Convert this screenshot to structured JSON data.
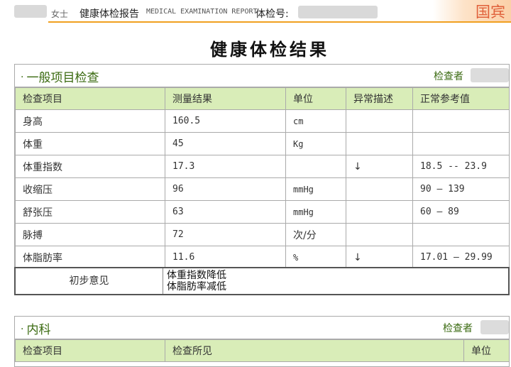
{
  "header": {
    "gender": "女士",
    "report_title": "健康体检报告",
    "report_title_en": "MEDICAL EXAMINATION REPORT",
    "exam_no_label": "体检号:",
    "logo_text": "国宾"
  },
  "page_title": "健康体检结果",
  "general_section": {
    "title": "一般项目检查",
    "examiner_label": "检查者",
    "columns": [
      "检查项目",
      "测量结果",
      "单位",
      "异常描述",
      "正常参考值"
    ],
    "rows": [
      {
        "item": "身高",
        "result": "160.5",
        "unit": "cm",
        "flag": "",
        "ref": ""
      },
      {
        "item": "体重",
        "result": "45",
        "unit": "Kg",
        "flag": "",
        "ref": ""
      },
      {
        "item": "体重指数",
        "result": "17.3",
        "unit": "",
        "flag": "↓",
        "ref": "18.5 -- 23.9"
      },
      {
        "item": "收缩压",
        "result": "96",
        "unit": "mmHg",
        "flag": "",
        "ref": "90 — 139"
      },
      {
        "item": "舒张压",
        "result": "63",
        "unit": "mmHg",
        "flag": "",
        "ref": "60 — 89"
      },
      {
        "item": "脉搏",
        "result": "72",
        "unit": "次/分",
        "flag": "",
        "ref": ""
      },
      {
        "item": "体脂肪率",
        "result": "11.6",
        "unit": "%",
        "flag": "↓",
        "ref": "17.01 — 29.99"
      }
    ],
    "opinion_label": "初步意见",
    "opinion_lines": [
      "体重指数降低",
      "体脂肪率减低"
    ]
  },
  "internal_section": {
    "title": "内科",
    "examiner_label": "检查者",
    "columns": [
      "检查项目",
      "检查所见",
      "单位"
    ]
  }
}
